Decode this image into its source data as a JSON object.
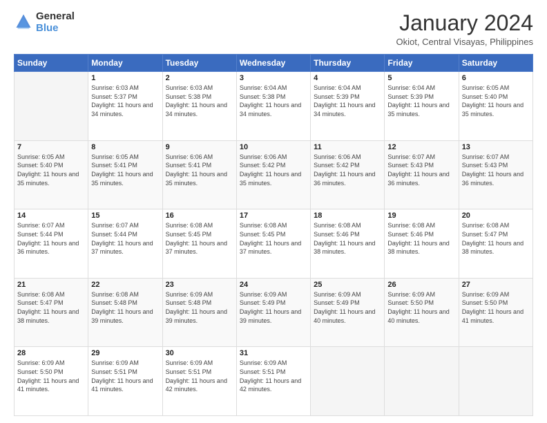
{
  "logo": {
    "general": "General",
    "blue": "Blue"
  },
  "title": "January 2024",
  "location": "Okiot, Central Visayas, Philippines",
  "weekdays": [
    "Sunday",
    "Monday",
    "Tuesday",
    "Wednesday",
    "Thursday",
    "Friday",
    "Saturday"
  ],
  "weeks": [
    [
      {
        "day": "",
        "sunrise": "",
        "sunset": "",
        "daylight": ""
      },
      {
        "day": "1",
        "sunrise": "Sunrise: 6:03 AM",
        "sunset": "Sunset: 5:37 PM",
        "daylight": "Daylight: 11 hours and 34 minutes."
      },
      {
        "day": "2",
        "sunrise": "Sunrise: 6:03 AM",
        "sunset": "Sunset: 5:38 PM",
        "daylight": "Daylight: 11 hours and 34 minutes."
      },
      {
        "day": "3",
        "sunrise": "Sunrise: 6:04 AM",
        "sunset": "Sunset: 5:38 PM",
        "daylight": "Daylight: 11 hours and 34 minutes."
      },
      {
        "day": "4",
        "sunrise": "Sunrise: 6:04 AM",
        "sunset": "Sunset: 5:39 PM",
        "daylight": "Daylight: 11 hours and 34 minutes."
      },
      {
        "day": "5",
        "sunrise": "Sunrise: 6:04 AM",
        "sunset": "Sunset: 5:39 PM",
        "daylight": "Daylight: 11 hours and 35 minutes."
      },
      {
        "day": "6",
        "sunrise": "Sunrise: 6:05 AM",
        "sunset": "Sunset: 5:40 PM",
        "daylight": "Daylight: 11 hours and 35 minutes."
      }
    ],
    [
      {
        "day": "7",
        "sunrise": "Sunrise: 6:05 AM",
        "sunset": "Sunset: 5:40 PM",
        "daylight": "Daylight: 11 hours and 35 minutes."
      },
      {
        "day": "8",
        "sunrise": "Sunrise: 6:05 AM",
        "sunset": "Sunset: 5:41 PM",
        "daylight": "Daylight: 11 hours and 35 minutes."
      },
      {
        "day": "9",
        "sunrise": "Sunrise: 6:06 AM",
        "sunset": "Sunset: 5:41 PM",
        "daylight": "Daylight: 11 hours and 35 minutes."
      },
      {
        "day": "10",
        "sunrise": "Sunrise: 6:06 AM",
        "sunset": "Sunset: 5:42 PM",
        "daylight": "Daylight: 11 hours and 35 minutes."
      },
      {
        "day": "11",
        "sunrise": "Sunrise: 6:06 AM",
        "sunset": "Sunset: 5:42 PM",
        "daylight": "Daylight: 11 hours and 36 minutes."
      },
      {
        "day": "12",
        "sunrise": "Sunrise: 6:07 AM",
        "sunset": "Sunset: 5:43 PM",
        "daylight": "Daylight: 11 hours and 36 minutes."
      },
      {
        "day": "13",
        "sunrise": "Sunrise: 6:07 AM",
        "sunset": "Sunset: 5:43 PM",
        "daylight": "Daylight: 11 hours and 36 minutes."
      }
    ],
    [
      {
        "day": "14",
        "sunrise": "Sunrise: 6:07 AM",
        "sunset": "Sunset: 5:44 PM",
        "daylight": "Daylight: 11 hours and 36 minutes."
      },
      {
        "day": "15",
        "sunrise": "Sunrise: 6:07 AM",
        "sunset": "Sunset: 5:44 PM",
        "daylight": "Daylight: 11 hours and 37 minutes."
      },
      {
        "day": "16",
        "sunrise": "Sunrise: 6:08 AM",
        "sunset": "Sunset: 5:45 PM",
        "daylight": "Daylight: 11 hours and 37 minutes."
      },
      {
        "day": "17",
        "sunrise": "Sunrise: 6:08 AM",
        "sunset": "Sunset: 5:45 PM",
        "daylight": "Daylight: 11 hours and 37 minutes."
      },
      {
        "day": "18",
        "sunrise": "Sunrise: 6:08 AM",
        "sunset": "Sunset: 5:46 PM",
        "daylight": "Daylight: 11 hours and 38 minutes."
      },
      {
        "day": "19",
        "sunrise": "Sunrise: 6:08 AM",
        "sunset": "Sunset: 5:46 PM",
        "daylight": "Daylight: 11 hours and 38 minutes."
      },
      {
        "day": "20",
        "sunrise": "Sunrise: 6:08 AM",
        "sunset": "Sunset: 5:47 PM",
        "daylight": "Daylight: 11 hours and 38 minutes."
      }
    ],
    [
      {
        "day": "21",
        "sunrise": "Sunrise: 6:08 AM",
        "sunset": "Sunset: 5:47 PM",
        "daylight": "Daylight: 11 hours and 38 minutes."
      },
      {
        "day": "22",
        "sunrise": "Sunrise: 6:08 AM",
        "sunset": "Sunset: 5:48 PM",
        "daylight": "Daylight: 11 hours and 39 minutes."
      },
      {
        "day": "23",
        "sunrise": "Sunrise: 6:09 AM",
        "sunset": "Sunset: 5:48 PM",
        "daylight": "Daylight: 11 hours and 39 minutes."
      },
      {
        "day": "24",
        "sunrise": "Sunrise: 6:09 AM",
        "sunset": "Sunset: 5:49 PM",
        "daylight": "Daylight: 11 hours and 39 minutes."
      },
      {
        "day": "25",
        "sunrise": "Sunrise: 6:09 AM",
        "sunset": "Sunset: 5:49 PM",
        "daylight": "Daylight: 11 hours and 40 minutes."
      },
      {
        "day": "26",
        "sunrise": "Sunrise: 6:09 AM",
        "sunset": "Sunset: 5:50 PM",
        "daylight": "Daylight: 11 hours and 40 minutes."
      },
      {
        "day": "27",
        "sunrise": "Sunrise: 6:09 AM",
        "sunset": "Sunset: 5:50 PM",
        "daylight": "Daylight: 11 hours and 41 minutes."
      }
    ],
    [
      {
        "day": "28",
        "sunrise": "Sunrise: 6:09 AM",
        "sunset": "Sunset: 5:50 PM",
        "daylight": "Daylight: 11 hours and 41 minutes."
      },
      {
        "day": "29",
        "sunrise": "Sunrise: 6:09 AM",
        "sunset": "Sunset: 5:51 PM",
        "daylight": "Daylight: 11 hours and 41 minutes."
      },
      {
        "day": "30",
        "sunrise": "Sunrise: 6:09 AM",
        "sunset": "Sunset: 5:51 PM",
        "daylight": "Daylight: 11 hours and 42 minutes."
      },
      {
        "day": "31",
        "sunrise": "Sunrise: 6:09 AM",
        "sunset": "Sunset: 5:51 PM",
        "daylight": "Daylight: 11 hours and 42 minutes."
      },
      {
        "day": "",
        "sunrise": "",
        "sunset": "",
        "daylight": ""
      },
      {
        "day": "",
        "sunrise": "",
        "sunset": "",
        "daylight": ""
      },
      {
        "day": "",
        "sunrise": "",
        "sunset": "",
        "daylight": ""
      }
    ]
  ]
}
